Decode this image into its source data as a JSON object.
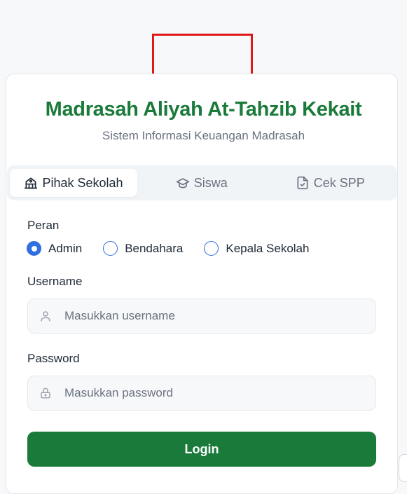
{
  "header": {
    "title": "Madrasah Aliyah At-Tahzib Kekait",
    "subtitle": "Sistem Informasi Keuangan Madrasah"
  },
  "tabs": [
    {
      "label": "Pihak Sekolah",
      "icon": "school-icon",
      "active": true
    },
    {
      "label": "Siswa",
      "icon": "graduation-cap-icon",
      "active": false
    },
    {
      "label": "Cek SPP",
      "icon": "file-check-icon",
      "active": false
    }
  ],
  "form": {
    "role_label": "Peran",
    "roles": [
      {
        "label": "Admin",
        "checked": true
      },
      {
        "label": "Bendahara",
        "checked": false
      },
      {
        "label": "Kepala Sekolah",
        "checked": false
      }
    ],
    "username_label": "Username",
    "username_placeholder": "Masukkan username",
    "password_label": "Password",
    "password_placeholder": "Masukkan password",
    "submit_label": "Login"
  },
  "colors": {
    "brand_green": "#1a7a3a",
    "radio_blue": "#2f6fdf",
    "logo_placeholder_border": "#e01818"
  }
}
